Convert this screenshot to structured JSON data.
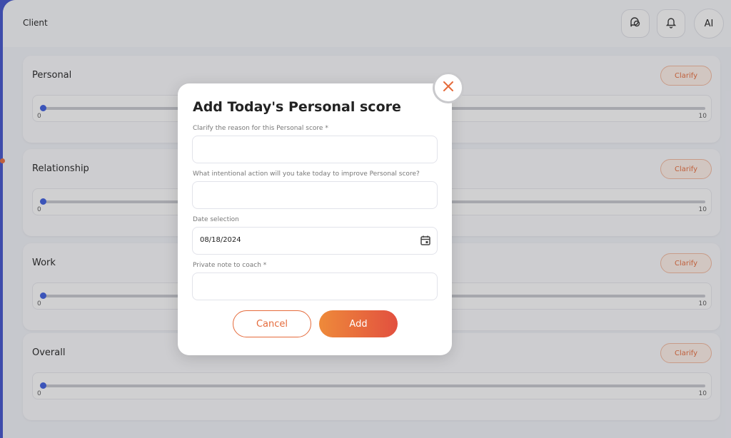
{
  "header": {
    "title": "Client",
    "chat_icon": "chat-bubbles-icon",
    "bell_icon": "bell-icon",
    "ai_label": "AI"
  },
  "cards": [
    {
      "label": "Personal",
      "clarify": "Clarify",
      "min": "0",
      "max": "10",
      "value": 0
    },
    {
      "label": "Relationship",
      "clarify": "Clarify",
      "min": "0",
      "max": "10",
      "value": 0
    },
    {
      "label": "Work",
      "clarify": "Clarify",
      "min": "0",
      "max": "10",
      "value": 0
    },
    {
      "label": "Overall",
      "clarify": "Clarify",
      "min": "0",
      "max": "10",
      "value": 0
    }
  ],
  "modal": {
    "title": "Add Today's Personal score",
    "fields": [
      {
        "label": "Clarify the reason for this Personal score *",
        "value": ""
      },
      {
        "label": "What intentional action will you take today to improve Personal score?",
        "value": ""
      },
      {
        "label": "Date selection",
        "value": "08/18/2024"
      },
      {
        "label": "Private note to coach *",
        "value": ""
      }
    ],
    "cancel_label": "Cancel",
    "add_label": "Add"
  },
  "colors": {
    "accent": "#e56b3c",
    "brand_blue": "#3f51c9",
    "slider_thumb": "#3b5bdb"
  }
}
